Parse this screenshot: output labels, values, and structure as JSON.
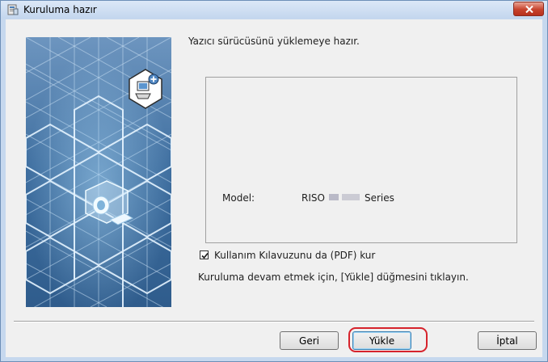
{
  "window": {
    "title": "Kuruluma hazır",
    "icons": {
      "app": "installer-icon",
      "close": "close-icon"
    }
  },
  "main": {
    "heading": "Yazıcı sürücüsünü yüklemeye hazır.",
    "model_label": "Model:",
    "model_prefix": "RISO",
    "model_suffix": "Series",
    "checkbox_label": "Kullanım Kılavuzunu da (PDF) kur",
    "checkbox_checked": true,
    "instruction": "Kuruluma devam etmek için, [Yükle] düğmesini tıklayın."
  },
  "buttons": {
    "back": "Geri",
    "install": "Yükle",
    "cancel": "İptal"
  },
  "colors": {
    "panel_blue": "#3d6fa0",
    "highlight_red": "#d6232c",
    "close_red": "#c7432d"
  }
}
